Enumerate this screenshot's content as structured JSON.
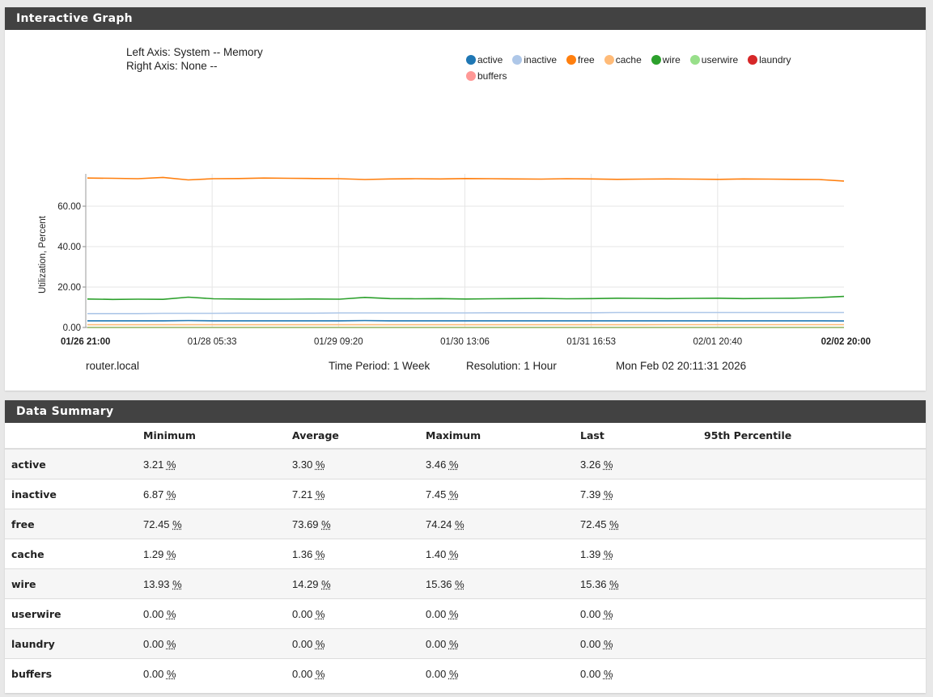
{
  "graph_panel": {
    "title": "Interactive Graph"
  },
  "axis_info": {
    "left": "Left Axis: System -- Memory",
    "right": "Right Axis: None --"
  },
  "legend": [
    {
      "name": "active",
      "color": "#1f77b4"
    },
    {
      "name": "inactive",
      "color": "#aec7e8"
    },
    {
      "name": "free",
      "color": "#ff7f0e"
    },
    {
      "name": "cache",
      "color": "#ffbb78"
    },
    {
      "name": "wire",
      "color": "#2ca02c"
    },
    {
      "name": "userwire",
      "color": "#98df8a"
    },
    {
      "name": "laundry",
      "color": "#d62728"
    },
    {
      "name": "buffers",
      "color": "#ff9896"
    }
  ],
  "chart_data": {
    "type": "line",
    "ylabel": "Utilization, Percent",
    "ylim": [
      0,
      76
    ],
    "yticks": [
      "0.00",
      "20.00",
      "40.00",
      "60.00"
    ],
    "xticks": [
      "01/26 21:00",
      "01/28 05:33",
      "01/29 09:20",
      "01/30 13:06",
      "01/31 16:53",
      "02/01 20:40",
      "02/02 20:00"
    ],
    "grid": true,
    "series": [
      {
        "name": "free",
        "color": "#ff7f0e",
        "values": [
          73.9,
          73.8,
          73.6,
          74.24,
          73.0,
          73.6,
          73.7,
          73.9,
          73.8,
          73.7,
          73.6,
          73.2,
          73.5,
          73.6,
          73.5,
          73.7,
          73.6,
          73.5,
          73.4,
          73.6,
          73.5,
          73.3,
          73.4,
          73.5,
          73.4,
          73.3,
          73.5,
          73.4,
          73.3,
          73.2,
          72.45
        ]
      },
      {
        "name": "wire",
        "color": "#2ca02c",
        "values": [
          14.1,
          13.9,
          14.0,
          13.93,
          15.0,
          14.2,
          14.1,
          13.95,
          14.0,
          14.1,
          14.0,
          14.9,
          14.3,
          14.2,
          14.3,
          14.1,
          14.2,
          14.3,
          14.4,
          14.2,
          14.3,
          14.5,
          14.4,
          14.3,
          14.4,
          14.5,
          14.3,
          14.4,
          14.5,
          14.8,
          15.36
        ]
      },
      {
        "name": "inactive",
        "color": "#aec7e8",
        "values": [
          6.9,
          6.9,
          6.9,
          7.0,
          7.0,
          7.0,
          7.1,
          7.1,
          7.1,
          7.1,
          7.2,
          7.2,
          7.2,
          7.2,
          7.2,
          7.2,
          7.3,
          7.3,
          7.3,
          7.3,
          7.3,
          7.4,
          7.4,
          7.4,
          7.4,
          7.4,
          7.4,
          7.4,
          7.4,
          7.4,
          7.39
        ]
      },
      {
        "name": "active",
        "color": "#1f77b4",
        "values": [
          3.3,
          3.3,
          3.3,
          3.3,
          3.4,
          3.3,
          3.3,
          3.3,
          3.3,
          3.3,
          3.3,
          3.4,
          3.3,
          3.3,
          3.3,
          3.3,
          3.3,
          3.3,
          3.3,
          3.3,
          3.3,
          3.3,
          3.3,
          3.3,
          3.3,
          3.3,
          3.3,
          3.3,
          3.3,
          3.3,
          3.26
        ]
      },
      {
        "name": "cache",
        "color": "#ffbb78",
        "values": [
          1.35,
          1.35,
          1.35,
          1.35,
          1.36,
          1.36,
          1.36,
          1.36,
          1.36,
          1.36,
          1.37,
          1.37,
          1.37,
          1.37,
          1.37,
          1.37,
          1.37,
          1.38,
          1.38,
          1.38,
          1.38,
          1.38,
          1.38,
          1.39,
          1.39,
          1.39,
          1.39,
          1.39,
          1.39,
          1.39,
          1.39
        ]
      },
      {
        "name": "userwire",
        "color": "#98df8a",
        "values": [
          0,
          0,
          0,
          0,
          0,
          0,
          0,
          0,
          0,
          0,
          0,
          0,
          0,
          0,
          0,
          0,
          0,
          0,
          0,
          0,
          0,
          0,
          0,
          0,
          0,
          0,
          0,
          0,
          0,
          0,
          0
        ]
      },
      {
        "name": "laundry",
        "color": "#d62728",
        "values": [
          0,
          0,
          0,
          0,
          0,
          0,
          0,
          0,
          0,
          0,
          0,
          0,
          0,
          0,
          0,
          0,
          0,
          0,
          0,
          0,
          0,
          0,
          0,
          0,
          0,
          0,
          0,
          0,
          0,
          0,
          0
        ]
      },
      {
        "name": "buffers",
        "color": "#ff9896",
        "values": [
          0,
          0,
          0,
          0,
          0,
          0,
          0,
          0,
          0,
          0,
          0,
          0,
          0,
          0,
          0,
          0,
          0,
          0,
          0,
          0,
          0,
          0,
          0,
          0,
          0,
          0,
          0,
          0,
          0,
          0,
          0
        ]
      }
    ]
  },
  "footer": {
    "host": "router.local",
    "period": "Time Period: 1 Week",
    "resolution": "Resolution: 1 Hour",
    "timestamp": "Mon Feb 02 20:11:31 2026"
  },
  "summary_panel": {
    "title": "Data Summary",
    "headers": [
      "",
      "Minimum",
      "Average",
      "Maximum",
      "Last",
      "95th Percentile"
    ],
    "unit": "%",
    "rows": [
      {
        "name": "active",
        "min": "3.21",
        "avg": "3.30",
        "max": "3.46",
        "last": "3.26",
        "p95": ""
      },
      {
        "name": "inactive",
        "min": "6.87",
        "avg": "7.21",
        "max": "7.45",
        "last": "7.39",
        "p95": ""
      },
      {
        "name": "free",
        "min": "72.45",
        "avg": "73.69",
        "max": "74.24",
        "last": "72.45",
        "p95": ""
      },
      {
        "name": "cache",
        "min": "1.29",
        "avg": "1.36",
        "max": "1.40",
        "last": "1.39",
        "p95": ""
      },
      {
        "name": "wire",
        "min": "13.93",
        "avg": "14.29",
        "max": "15.36",
        "last": "15.36",
        "p95": ""
      },
      {
        "name": "userwire",
        "min": "0.00",
        "avg": "0.00",
        "max": "0.00",
        "last": "0.00",
        "p95": ""
      },
      {
        "name": "laundry",
        "min": "0.00",
        "avg": "0.00",
        "max": "0.00",
        "last": "0.00",
        "p95": ""
      },
      {
        "name": "buffers",
        "min": "0.00",
        "avg": "0.00",
        "max": "0.00",
        "last": "0.00",
        "p95": ""
      }
    ]
  }
}
